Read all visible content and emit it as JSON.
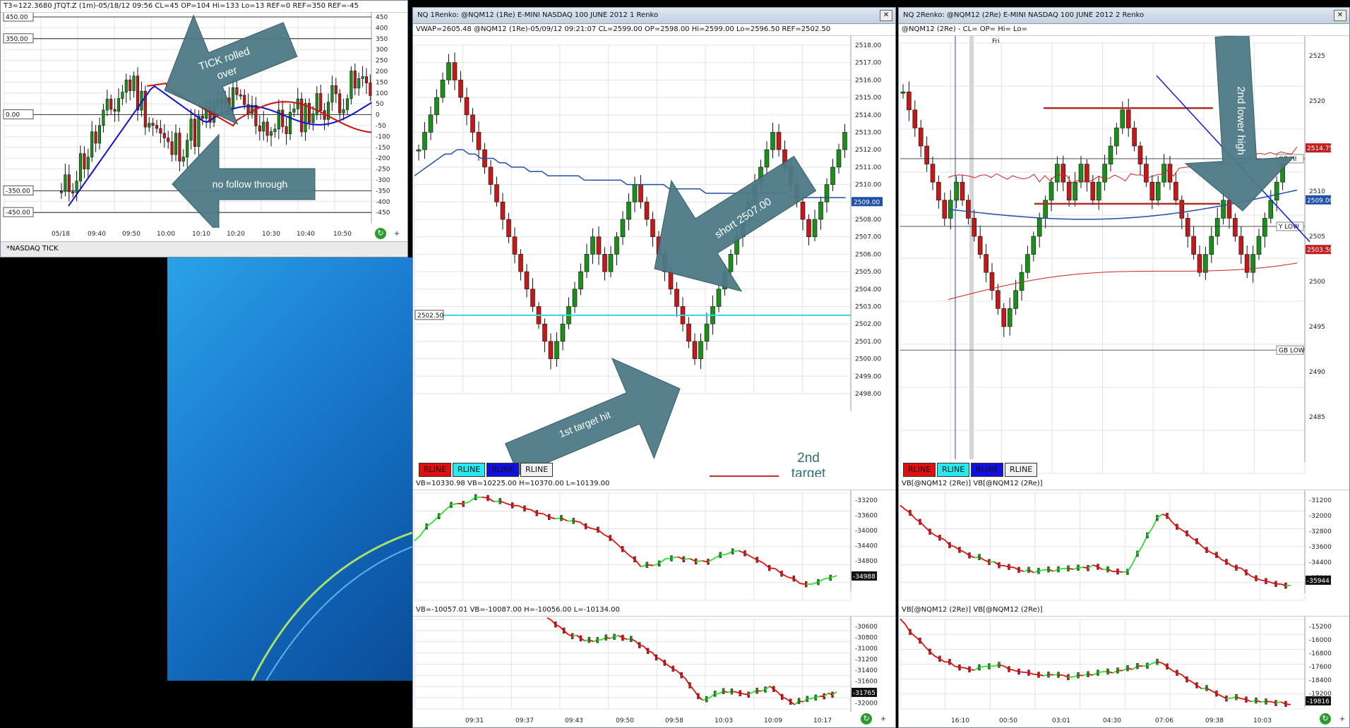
{
  "colors": {
    "up": "#1a8f1a",
    "down": "#c21a1a",
    "vwap": "#1f4fa8",
    "ma": "#d01010",
    "arrow": "#4d7a86",
    "ref": "#30d8e8"
  },
  "tick_window": {
    "header": "T3=122.3680  JTQT.Z (1m)-05/18/12 09:56 CL=45 OP=104 Hi=133 Lo=13   REF=0  REF=350  REF=-45",
    "tab_label": "*NASDAQ TICK",
    "ref_labels": [
      "450.00",
      "350.00",
      "0.00",
      "-350.00",
      "-450.00"
    ],
    "y_labels": [
      "450",
      "400",
      "350",
      "300",
      "250",
      "200",
      "150",
      "100",
      "50",
      "0",
      "-50",
      "-100",
      "-150",
      "-200",
      "-250",
      "-300",
      "-350",
      "-400",
      "-450"
    ],
    "x_labels": [
      "05/18",
      "09:40",
      "09:50",
      "10:00",
      "10:10",
      "10:20",
      "10:30",
      "10:40",
      "10:50"
    ],
    "annot1": "TICK rolled over",
    "annot2": "no follow through"
  },
  "renko1": {
    "title": "NQ 1Renko: @NQM12 (1Re) E-MINI NASDAQ 100 JUNE 2012 1 Renko",
    "header": "VWAP=2605.48  @NQM12 (1Re)-05/09/12 09:21:07 CL=2599.00 OP=2598.00 Hi=2599.00 Lo=2596.50   REF=2502.50",
    "y_labels": [
      "2518.00",
      "2517.00",
      "2516.00",
      "2515.00",
      "2514.00",
      "2513.00",
      "2512.00",
      "2511.00",
      "2510.00",
      "2509.00",
      "2508.00",
      "2507.00",
      "2506.00",
      "2505.00",
      "2504.00",
      "2503.00",
      "2502.00",
      "2501.00",
      "2500.00",
      "2499.00",
      "2498.00"
    ],
    "price_tag": "2509.00",
    "ref_tag": "2502.50",
    "annot_short": "short 2507.00",
    "annot_target": "1st target hit",
    "second_target": "2nd target",
    "buttons": [
      "RLINE",
      "RLINE",
      "RLINE",
      "RLINE"
    ],
    "vb1_header": "VB=10330.98  VB=10225.00 H=10370.00 L=10139.00",
    "vb1_labels": [
      "-33200",
      "-33600",
      "-34000",
      "-34400",
      "-34800",
      "-35200"
    ],
    "vb1_tag": "-34988",
    "vb2_header": "VB=-10057.01  VB=-10087.00 H=-10056.00 L=-10134.00",
    "vb2_labels": [
      "-30600",
      "-30800",
      "-31000",
      "-31200",
      "-31400",
      "-31600",
      "-31800",
      "-32000"
    ],
    "vb2_tag": "-31765",
    "x_labels": [
      "09:31",
      "09:37",
      "09:43",
      "09:50",
      "09:58",
      "10:03",
      "10:09",
      "10:17"
    ]
  },
  "renko2": {
    "title": "NQ 2Renko: @NQM12 (2Re) E-MINI NASDAQ 100 JUNE 2012 2 Renko",
    "header": "@NQM12 (2Re) - CL= OP= Hi= Lo=",
    "fri_label": "Fri",
    "y_labels": [
      "2525",
      "2520",
      "2515",
      "2510",
      "2505",
      "2500",
      "2495",
      "2490",
      "2485"
    ],
    "price_tag": "2509.00",
    "tag_upper": "2514.75",
    "tag_lower": "2503.50",
    "gb_hi": "GB HI",
    "y_low": "Y LOW",
    "gb_low": "GB LOW",
    "annot_lower_high": "2nd lower high",
    "buttons": [
      "RLINE",
      "RLINE",
      "RLINE",
      "RLINE"
    ],
    "vb1_header": "VB[@NQM12 (2Re)]  VB[@NQM12 (2Re)]",
    "vb1_labels": [
      "-31200",
      "-32000",
      "-32800",
      "-33600",
      "-34400",
      "-35200"
    ],
    "vb1_tag": "-35944",
    "vb2_header": "VB[@NQM12 (2Re)]  VB[@NQM12 (2Re)]",
    "vb2_labels": [
      "-15200",
      "-16000",
      "-16800",
      "-17600",
      "-18400",
      "-19200"
    ],
    "vb2_tag": "-19816",
    "x_labels": [
      "16:10",
      "00:50",
      "03:01",
      "04:30",
      "07:06",
      "09:38",
      "10:03"
    ]
  }
}
